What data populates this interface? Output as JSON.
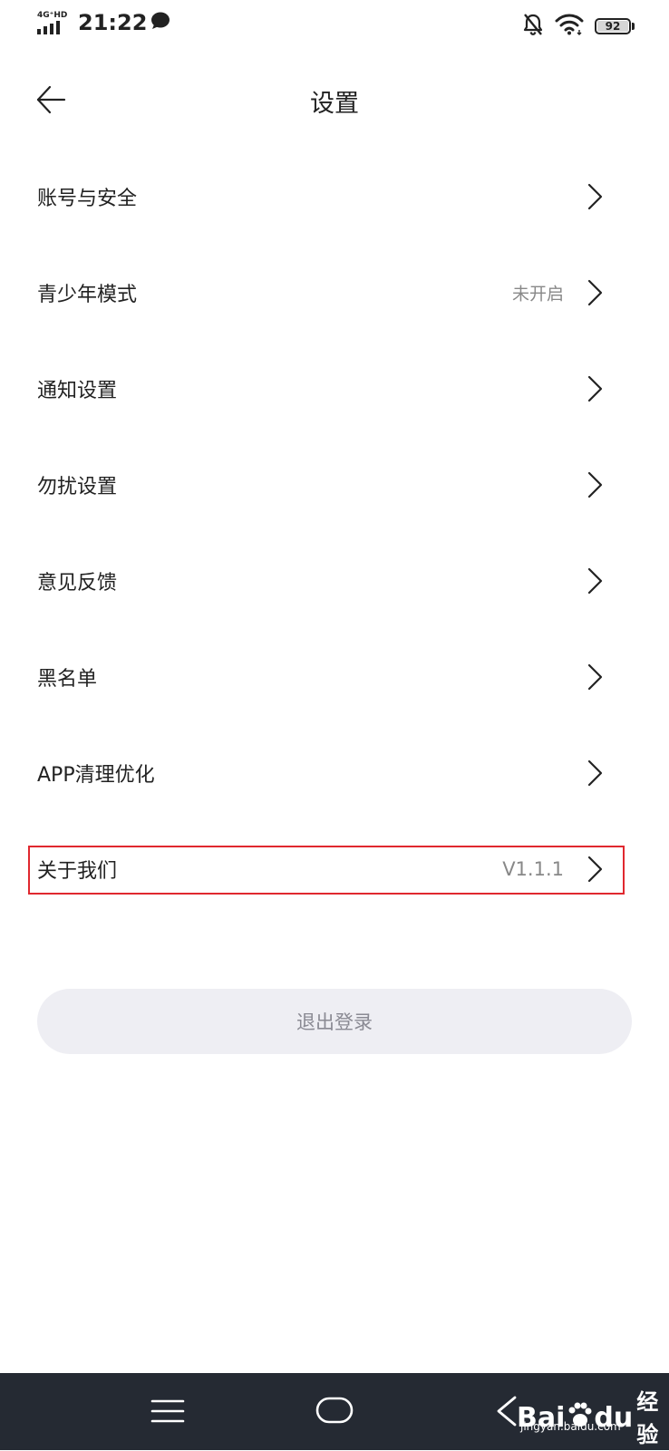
{
  "status_bar": {
    "network": "4G⁺HD",
    "time": "21:22",
    "battery": "92",
    "icons": [
      "signal-icon",
      "chat-bubble-icon",
      "bell-muted-icon",
      "wifi-icon",
      "battery-icon"
    ]
  },
  "header": {
    "title": "设置",
    "back_icon": "arrow-left-icon"
  },
  "settings": {
    "items": [
      {
        "label": "账号与安全",
        "value": ""
      },
      {
        "label": "青少年模式",
        "value": "未开启"
      },
      {
        "label": "通知设置",
        "value": ""
      },
      {
        "label": "勿扰设置",
        "value": ""
      },
      {
        "label": "意见反馈",
        "value": ""
      },
      {
        "label": "黑名单",
        "value": ""
      },
      {
        "label": "APP清理优化",
        "value": ""
      },
      {
        "label": "关于我们",
        "value": "V1.1.1"
      }
    ]
  },
  "logout": {
    "label": "退出登录"
  },
  "nav_bar": {
    "icons": [
      "menu-icon",
      "home-icon",
      "back-icon"
    ]
  },
  "watermark": {
    "brand": "Bai",
    "brand_suffix": "du",
    "brand_cn": "经验",
    "url": "jingyan.baidu.com"
  },
  "colors": {
    "highlight": "#e0282f",
    "logout_bg": "#eeeef3",
    "nav_bg": "#252a33",
    "secondary_text": "#888888"
  }
}
